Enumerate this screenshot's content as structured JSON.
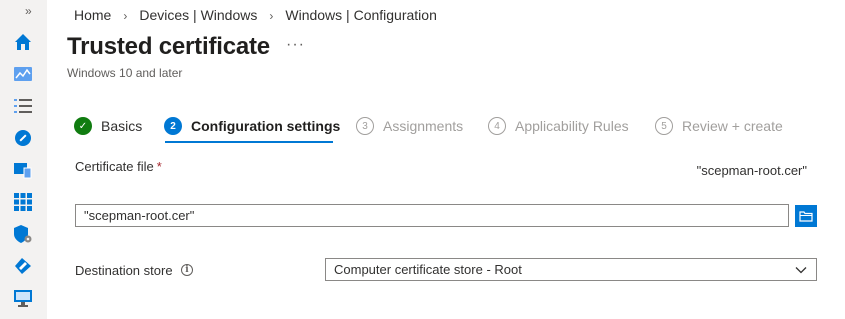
{
  "breadcrumb": [
    "Home",
    "Devices | Windows",
    "Windows | Configuration"
  ],
  "title": "Trusted certificate",
  "more_label": "···",
  "subtitle": "Windows 10 and later",
  "steps": [
    {
      "number": "✓",
      "label": "Basics",
      "state": "done"
    },
    {
      "number": "2",
      "label": "Configuration settings",
      "state": "active"
    },
    {
      "number": "3",
      "label": "Assignments",
      "state": "future"
    },
    {
      "number": "4",
      "label": "Applicability Rules",
      "state": "future"
    },
    {
      "number": "5",
      "label": "Review + create",
      "state": "future"
    }
  ],
  "certificate": {
    "label": "Certificate file",
    "required_mark": "*",
    "selected_value": "\"scepman-root.cer\"",
    "input_value": "\"scepman-root.cer\""
  },
  "destination": {
    "label": "Destination store",
    "info_glyph": "i",
    "selected": "Computer certificate store - Root"
  },
  "sidebar": {
    "expand_glyph": "»",
    "icons": [
      "home-icon",
      "dashboard-icon",
      "all-services-icon",
      "devices-icon",
      "apps-icon",
      "endpoint-security-icon",
      "tenant-admin-icon",
      "troubleshooting-icon"
    ]
  },
  "colors": {
    "accent": "#0078d4",
    "success": "#107c10",
    "rail_bg": "#f3f2f1"
  }
}
